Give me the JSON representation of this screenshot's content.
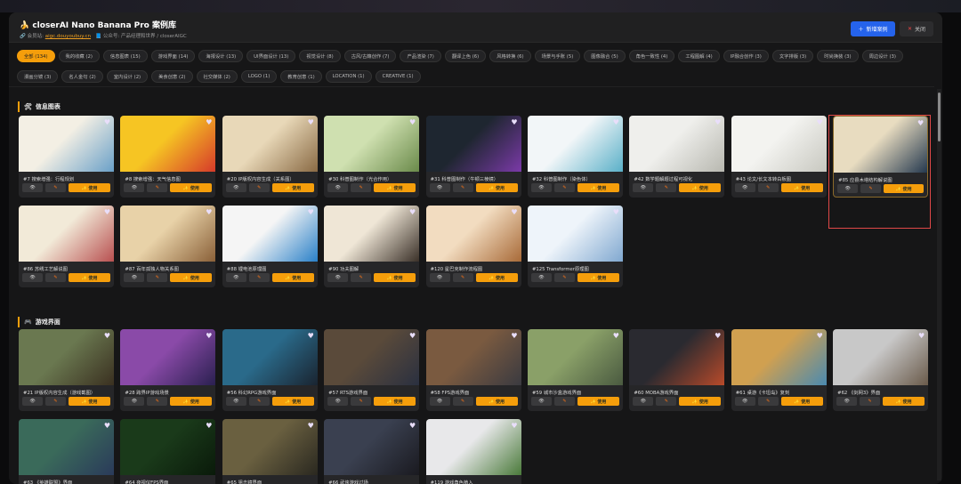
{
  "header": {
    "title": "closerAI Nano Banana Pro 案例库",
    "site_label": "会员站:",
    "site_link": "aigc.douyoubuy.cn",
    "account_label": "公众号: 产品经理和世界 / closerAIGC",
    "new_button": "新增案例",
    "close_button": "关闭"
  },
  "filters": [
    "全部 (134)",
    "我的收藏 (2)",
    "信息图表 (15)",
    "游戏界面 (14)",
    "海报设计 (13)",
    "UI界面设计 (13)",
    "视觉设计 (8)",
    "古风/古籍创作 (7)",
    "产品渲染 (7)",
    "翻译上色 (6)",
    "风格转换 (6)",
    "场景与手账 (5)",
    "图像融合 (5)",
    "角色一致性 (4)",
    "工程图解 (4)",
    "IP融合创作 (3)",
    "文字排版 (3)",
    "时尚换装 (3)",
    "周边设计 (3)",
    "漫画分镜 (3)",
    "名人金句 (2)",
    "室内设计 (2)",
    "美食创意 (2)",
    "社交媒体 (2)",
    "LOGO (1)",
    "教育创意 (1)",
    "LOCATION (1)",
    "CREATIVE (1)"
  ],
  "buttons": {
    "view": "👁",
    "edit": "✎",
    "use": "✨ 使用"
  },
  "sections": [
    {
      "title": "信息图表",
      "icon": "🛠",
      "cards": [
        {
          "title": "#7 搜索增强：行程规划",
          "c1": "#f3efe4",
          "c2": "#6aa0c8"
        },
        {
          "title": "#8 搜索增强：天气信息图",
          "c1": "#f6c523",
          "c2": "#d63a2a"
        },
        {
          "title": "#20 IP版权内容生成（关系图）",
          "c1": "#e8d8b8",
          "c2": "#8a6a44"
        },
        {
          "title": "#30 科普图制作（光合作用）",
          "c1": "#cfe0b0",
          "c2": "#6a8a4a"
        },
        {
          "title": "#31 科普图制作（牛顿三棱镜）",
          "c1": "#1e2630",
          "c2": "#7b3aa8"
        },
        {
          "title": "#32 科普图制作（染色体）",
          "c1": "#f2f6f8",
          "c2": "#5ab0c8"
        },
        {
          "title": "#42 数学题解题过程可视化",
          "c1": "#efefec",
          "c2": "#b8b8b0"
        },
        {
          "title": "#43 论文/长文本转白板图",
          "c1": "#f3f3f0",
          "c2": "#c8c8c0"
        },
        {
          "title": "#85 应县木塔结构解说图",
          "c1": "#e8dcc0",
          "c2": "#24384e",
          "highlight": true
        },
        {
          "title": "#86 苏绣工艺解说图",
          "c1": "#f2ead8",
          "c2": "#b85050"
        },
        {
          "title": "#87 百年孤独人物关系图",
          "c1": "#e8d2a8",
          "c2": "#8a6038"
        },
        {
          "title": "#88 锂电池原理图",
          "c1": "#f5f5f5",
          "c2": "#2a80c8"
        },
        {
          "title": "#90 功夫图解",
          "c1": "#efe6d6",
          "c2": "#3a3028"
        },
        {
          "title": "#120 星巴克制作流程图",
          "c1": "#f2dcc0",
          "c2": "#a86a38"
        },
        {
          "title": "#125 Transformer原理图",
          "c1": "#eef4fa",
          "c2": "#80a8d0"
        }
      ]
    },
    {
      "title": "游戏界面",
      "icon": "🎮",
      "cards": [
        {
          "title": "#21 IP版权内容生成（游戏截图）",
          "c1": "#6a7850",
          "c2": "#3a3020"
        },
        {
          "title": "#28 跨界IP游戏场景",
          "c1": "#8a4aa8",
          "c2": "#2a2050"
        },
        {
          "title": "#56 科幻RPG游戏界面",
          "c1": "#2a6a8a",
          "c2": "#1a2430"
        },
        {
          "title": "#57 RTS游戏界面",
          "c1": "#5a4a3a",
          "c2": "#2a3040"
        },
        {
          "title": "#58 FPS游戏界面",
          "c1": "#7a5a40",
          "c2": "#3a3a40"
        },
        {
          "title": "#59 城市沙盒游戏界面",
          "c1": "#8aa068",
          "c2": "#4a5a40"
        },
        {
          "title": "#60 MOBA游戏界面",
          "c1": "#2a2a30",
          "c2": "#b84a2a"
        },
        {
          "title": "#61 桌游《卡坦岛》复刻",
          "c1": "#d0a050",
          "c2": "#4a8ab0"
        },
        {
          "title": "#62 《剑网3》界面",
          "c1": "#c8c8c8",
          "c2": "#6a5a4a"
        },
        {
          "title": "#63 《英雄联盟》界面",
          "c1": "#3a6a5a",
          "c2": "#2a3a5a"
        },
        {
          "title": "#64 夜视仪FPS界面",
          "c1": "#1a3a1a",
          "c2": "#0a1a0a"
        },
        {
          "title": "#65 狙击镜界面",
          "c1": "#6a6040",
          "c2": "#2a2820"
        },
        {
          "title": "#66 武侠游戏过场",
          "c1": "#3a4050",
          "c2": "#1a1a20"
        },
        {
          "title": "#119 游戏角色植入",
          "c1": "#e8e8ea",
          "c2": "#4a7a3a"
        }
      ]
    }
  ]
}
